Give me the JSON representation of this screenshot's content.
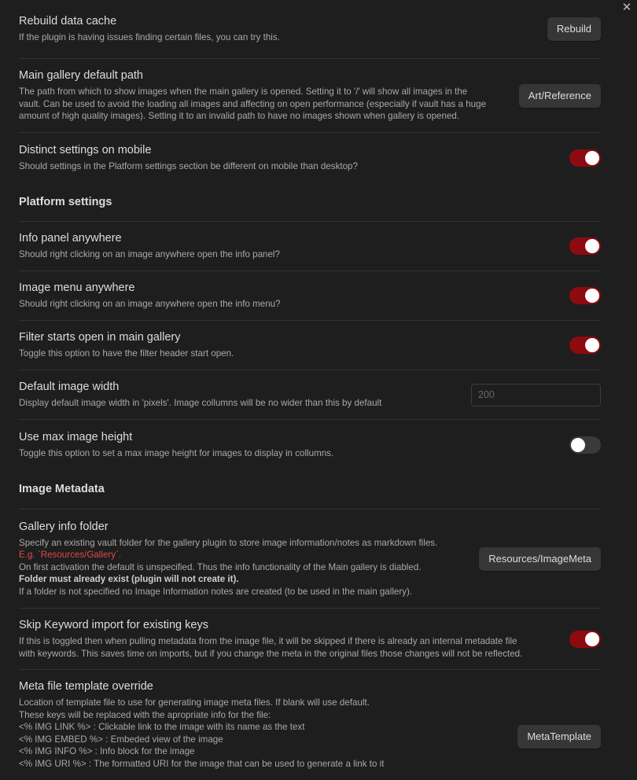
{
  "close_label": "✕",
  "rebuild": {
    "name": "Rebuild data cache",
    "desc": "If the plugin is having issues finding certain files, you can try this.",
    "button": "Rebuild"
  },
  "gallery_path": {
    "name": "Main gallery default path",
    "desc_lines": [
      "The path from which to show images when the main gallery is opened. Setting it to '/' will show all images in the",
      "vault. Can be used to avoid the loading all images and affecting on open performance (especially if vault has a huge",
      "amount of high quality images). Setting it to an invalid path to have no images shown when gallery is opened."
    ],
    "button": "Art/Reference"
  },
  "distinct_mobile": {
    "name": "Distinct settings on mobile",
    "desc": "Should settings in the Platform settings section be different on mobile than desktop?",
    "enabled": true
  },
  "platform_heading": "Platform settings",
  "info_panel": {
    "name": "Info panel anywhere",
    "desc": "Should right clicking on an image anywhere open the info panel?",
    "enabled": true
  },
  "image_menu": {
    "name": "Image menu anywhere",
    "desc": "Should right clicking on an image anywhere open the info menu?",
    "enabled": true
  },
  "filter_open": {
    "name": "Filter starts open in main gallery",
    "desc": "Toggle this option to have the filter header start open.",
    "enabled": true
  },
  "image_width": {
    "name": "Default image width",
    "desc": "Display default image width in 'pixels'. Image collumns will be no wider than this by default",
    "placeholder": "200"
  },
  "max_height": {
    "name": "Use max image height",
    "desc": "Toggle this option to set a max image height for images to display in collumns.",
    "enabled": false
  },
  "metadata_heading": "Image Metadata",
  "info_folder": {
    "name": "Gallery info folder",
    "line1": "Specify an existing vault folder for the gallery plugin to store image information/notes as markdown files.",
    "example": "E.g. `Resources/Gallery`.",
    "line3": "On first activation the default is unspecified. Thus the info functionality of the Main gallery is diabled.",
    "bold": "Folder must already exist (plugin will not create it).",
    "line5": "If a folder is not specified no Image Information notes are created (to be used in the main gallery).",
    "button": "Resources/ImageMeta"
  },
  "skip_keyword": {
    "name": "Skip Keyword import for existing keys",
    "desc_lines": [
      "If this is toggled then when pulling metadata from the image file, it will be skipped if there is already an internal metadate file",
      "with keywords. This saves time on imports, but if you change the meta in the original files those changes will not be reflected."
    ],
    "enabled": true
  },
  "meta_template": {
    "name": "Meta file template override",
    "desc_lines": [
      "Location of template file to use for generating image meta files. If blank will use default.",
      "These keys will be replaced with the apropriate info for the file:",
      "<% IMG LINK %> : Clickable link to the image with its name as the text",
      "<% IMG EMBED %> : Embeded view of the image",
      "<% IMG INFO %> : Info block for the image",
      "<% IMG URI %> : The formatted URI for the image that can be used to generate a link to it"
    ],
    "button": "MetaTemplate"
  }
}
